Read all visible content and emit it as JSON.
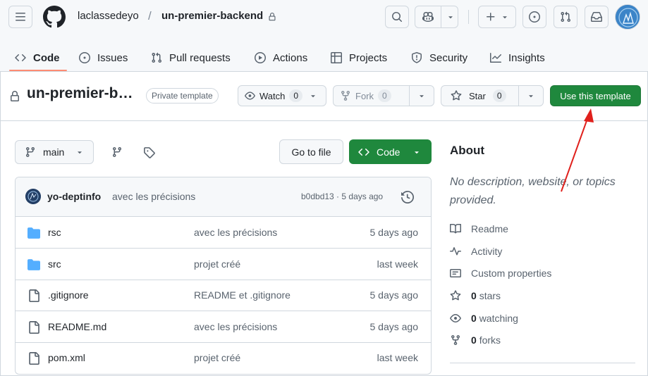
{
  "header": {
    "owner": "laclassedeyo",
    "separator": "/",
    "repo": "un-premier-backend"
  },
  "tabs": [
    {
      "label": "Code"
    },
    {
      "label": "Issues"
    },
    {
      "label": "Pull requests"
    },
    {
      "label": "Actions"
    },
    {
      "label": "Projects"
    },
    {
      "label": "Security"
    },
    {
      "label": "Insights"
    }
  ],
  "repo_bar": {
    "title": "un-premier-b…",
    "visibility": "Private template",
    "watch_label": "Watch",
    "watch_count": "0",
    "fork_label": "Fork",
    "fork_count": "0",
    "star_label": "Star",
    "star_count": "0",
    "template_label": "Use this template"
  },
  "toolbar": {
    "branch": "main",
    "goto_file": "Go to file",
    "code_label": "Code"
  },
  "commit": {
    "author": "yo-deptinfo",
    "message": "avec les précisions",
    "hash_time": "b0dbd13 · 5 days ago"
  },
  "files": [
    {
      "type": "folder",
      "name": "rsc",
      "message": "avec les précisions",
      "time": "5 days ago"
    },
    {
      "type": "folder",
      "name": "src",
      "message": "projet créé",
      "time": "last week"
    },
    {
      "type": "file",
      "name": ".gitignore",
      "message": "README et .gitignore",
      "time": "5 days ago"
    },
    {
      "type": "file",
      "name": "README.md",
      "message": "avec les précisions",
      "time": "5 days ago"
    },
    {
      "type": "file",
      "name": "pom.xml",
      "message": "projet créé",
      "time": "last week"
    }
  ],
  "about": {
    "title": "About",
    "description": "No description, website, or topics provided.",
    "readme": "Readme",
    "activity": "Activity",
    "custom_properties": "Custom properties",
    "stars_count": "0",
    "stars_label": "stars",
    "watching_count": "0",
    "watching_label": "watching",
    "forks_count": "0",
    "forks_label": "forks"
  },
  "colors": {
    "accent_green": "#1f883d",
    "tab_underline": "#fd8c73",
    "folder_blue": "#54aeff",
    "annotation_arrow": "#e0201c"
  }
}
